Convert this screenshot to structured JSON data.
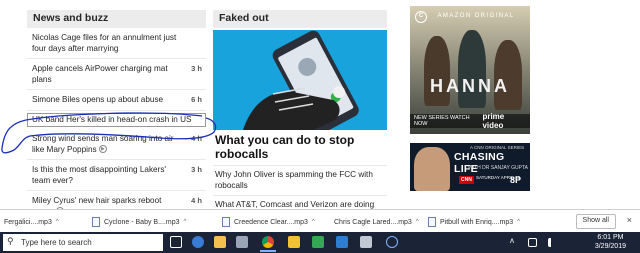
{
  "news": {
    "heading": "News and buzz",
    "items": [
      {
        "text": "Nicolas Cage files for an annulment just four days after marrying",
        "time": ""
      },
      {
        "text": "Apple cancels AirPower charging mat plans",
        "time": "3 h"
      },
      {
        "text": "Simone Biles opens up about abuse",
        "time": "6 h"
      },
      {
        "text": "UK band Her's killed in head-on crash in US",
        "time": ""
      },
      {
        "text": "Strong wind sends man soaring into air like Mary Poppins",
        "time": "4 h"
      },
      {
        "text": "Is this the most disappointing Lakers' team ever?",
        "time": "3 h"
      },
      {
        "text": "Miley Cyrus' new hair sparks reboot rumor",
        "time": "4 h"
      }
    ]
  },
  "faked": {
    "heading": "Faked out",
    "title": "What you can do to stop robocalls",
    "items": [
      {
        "text": "Why John Oliver is spamming the FCC with robocalls"
      },
      {
        "text": "What AT&T, Comcast and Verizon are doing about robocalls"
      }
    ]
  },
  "ads": {
    "hanna": {
      "badge": "C",
      "top": "AMAZON ORIGINAL",
      "title": "HANNA",
      "banner_left": "NEW SERIES WATCH NOW",
      "banner_right": "prime video"
    },
    "chasing": {
      "sub1": "A CNN ORIGINAL SERIES",
      "title": "CHASING LIFE",
      "sub2": "WITH DR SANJAY GUPTA",
      "network": "CNN",
      "date": "SATURDAY APRIL 13",
      "time": "8P"
    }
  },
  "downloads": {
    "items": [
      "Fergalici....mp3",
      "Cyclone - Baby B....mp3",
      "Creedence Clear....mp3",
      "Chris Cagle Lared....mp3",
      "Pitbull with Enriq....mp3"
    ],
    "show_all": "Show all",
    "close": "×"
  },
  "taskbar": {
    "search_placeholder": "Type here to search",
    "time": "6:01 PM",
    "date": "3/29/2019",
    "tray_glyph": "ʌ"
  },
  "colors": {
    "annotation": "#1a2fb8",
    "phone_bg": "#19a3dd",
    "taskbar": "#1b2436"
  }
}
